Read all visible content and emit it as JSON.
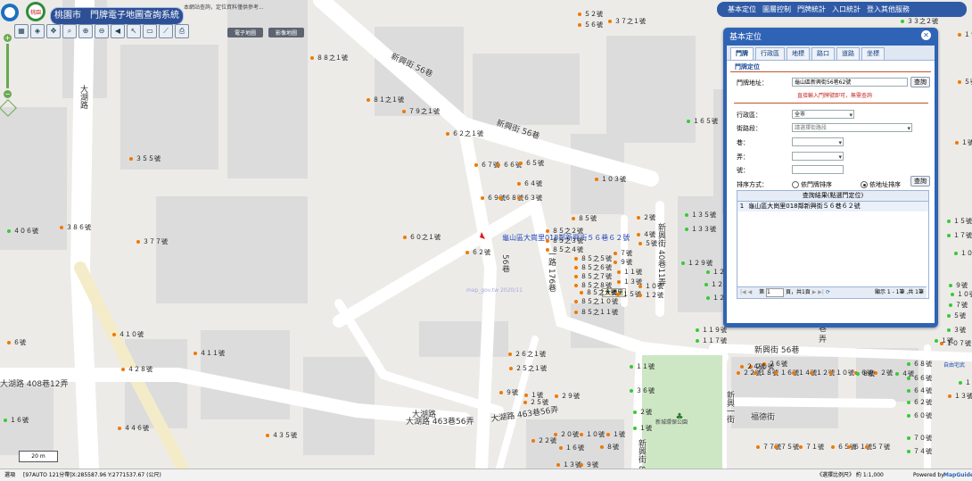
{
  "header": {
    "logo_text": "桃園",
    "title": "桃園市　門牌電子地圖查詢系統",
    "hint": "本網站查詢，定位資料僅供參考..."
  },
  "tools": {
    "map_tabs": [
      "電子地圖",
      "影像地圖"
    ]
  },
  "top_menu": [
    "基本定位",
    "圖層控制",
    "門牌統計",
    "入口統計",
    "登入其他服務"
  ],
  "panel": {
    "title": "基本定位",
    "close": "✕",
    "tabs": [
      "門牌",
      "行政區",
      "地標",
      "路口",
      "道路",
      "坐標"
    ],
    "section": "門牌定位",
    "address_label": "門牌地址：",
    "address_value": "龜山區新興街56巷62號",
    "query_button": "查詢",
    "tip": "直接輸入門牌號即可，無需查詢",
    "district_label": "行政區：",
    "district_value": "全市",
    "street_label": "街路段：",
    "street_placeholder": "請選擇街路段",
    "lane_label": "巷：",
    "alley_label": "弄：",
    "number_label": "號：",
    "sort_label": "排序方式：",
    "sort_option1": "依門牌排序",
    "sort_option2": "依地址排序",
    "query_button2": "查詢",
    "grid_header": "查詢結果(點選門定位)",
    "grid_row_index": "1",
    "grid_row_value": "龜山區大崗里018鄰新興街５６巷６２號",
    "pager_label": "第",
    "pager_value": "1",
    "pager_total": "頁，共1頁",
    "pager_info": "顯示 1 - 1筆 ,共 1筆"
  },
  "map_labels": {
    "roads": {
      "xinxing56a": "新興街 56巷",
      "xinxing56b": "新興街 56巷",
      "dahu": "大湖路",
      "dahu_b": "大湖路",
      "dahu408": "大湖路 408巷12弄",
      "dahu463": "大湖路 463巷56弄",
      "dahu463b": "大湖路 463巷56弄",
      "lane176": "一路 176巷",
      "lane56v": "56巷",
      "xinxing40": "新興街 40巷11弄",
      "xinxing56c": "新興街 56巷",
      "fude": "福德街",
      "xinxing1": "新興一街",
      "lane85": "新興街 85巷",
      "lane_small": "巷 弄"
    },
    "marker_label": "龜山區大崗里018鄰新興街５６巷６２號",
    "tooltip": "大崗里",
    "watermark": "map_gov.tw 2020/11",
    "park": "新城環保公園",
    "baghuo": "自由宅武"
  },
  "addresses_orange": [
    [
      "５２號",
      648,
      12
    ],
    [
      "５６號",
      648,
      24
    ],
    [
      "３７之１號",
      682,
      20
    ],
    [
      "８８之１號",
      348,
      61
    ],
    [
      "８１之１號",
      411,
      108
    ],
    [
      "７９之１號",
      451,
      121
    ],
    [
      "６２之１號",
      500,
      146
    ],
    [
      "６７號",
      532,
      181
    ],
    [
      "６６號",
      557,
      181
    ],
    [
      "６５號",
      582,
      179
    ],
    [
      "３５５號",
      145,
      174
    ],
    [
      "６４號",
      580,
      202
    ],
    [
      "６９號",
      539,
      218
    ],
    [
      "６８號",
      559,
      218
    ],
    [
      "６３號",
      580,
      218
    ],
    [
      "１０３號",
      667,
      197
    ],
    [
      "３８６號",
      67,
      251
    ],
    [
      "３７７號",
      153,
      267
    ],
    [
      "６０之１號",
      452,
      262
    ],
    [
      "６２號",
      522,
      279
    ],
    [
      "８５號",
      641,
      241
    ],
    [
      "８５之２號",
      612,
      255
    ],
    [
      "８５之３號",
      612,
      266
    ],
    [
      "８５之４號",
      612,
      276
    ],
    [
      "８５之５號",
      644,
      286
    ],
    [
      "８５之６號",
      644,
      296
    ],
    [
      "８５之７號",
      644,
      306
    ],
    [
      "８５之８號",
      644,
      316
    ],
    [
      "８５之９號",
      650,
      324
    ],
    [
      "８５之１０號",
      644,
      334
    ],
    [
      "８５之１１號",
      644,
      346
    ],
    [
      "２號",
      714,
      240
    ],
    [
      "４號",
      714,
      259
    ],
    [
      "５號",
      716,
      269
    ],
    [
      "７號",
      688,
      280
    ],
    [
      "９號",
      688,
      290
    ],
    [
      "１１號",
      692,
      301
    ],
    [
      "１３號",
      692,
      312
    ],
    [
      "１５號",
      691,
      326
    ],
    [
      "１０號",
      716,
      317
    ],
    [
      "１２號",
      716,
      327
    ],
    [
      "６號",
      8,
      380
    ],
    [
      "４１０號",
      126,
      371
    ],
    [
      "４１１號",
      217,
      392
    ],
    [
      "４２８號",
      136,
      410
    ],
    [
      "２６之１號",
      570,
      393
    ],
    [
      "２５之１號",
      571,
      409
    ],
    [
      "９號",
      560,
      436
    ],
    [
      "１號",
      588,
      439
    ],
    [
      "２５號",
      587,
      447
    ],
    [
      "２９號",
      622,
      440
    ],
    [
      "４４６號",
      132,
      476
    ],
    [
      "４３５號",
      298,
      484
    ],
    [
      "２２號",
      596,
      490
    ],
    [
      "２０號",
      621,
      483
    ],
    [
      "１０號",
      650,
      483
    ],
    [
      "１號",
      680,
      483
    ],
    [
      "１６號",
      627,
      498
    ],
    [
      "８號",
      673,
      497
    ],
    [
      "１３號",
      624,
      517
    ],
    [
      "９號",
      650,
      517
    ],
    [
      "１９號",
      1074,
      35
    ],
    [
      "５號",
      1074,
      88
    ],
    [
      "１號",
      1071,
      156
    ],
    [
      "１３號",
      1063,
      440
    ],
    [
      "１０７號",
      1054,
      381
    ],
    [
      "２０號",
      840,
      407
    ],
    [
      "２６號",
      855,
      404
    ],
    [
      "２４號",
      830,
      407
    ],
    [
      "２２號",
      826,
      414
    ],
    [
      "１８號",
      845,
      414
    ],
    [
      "１６號",
      868,
      414
    ],
    [
      "１４號",
      888,
      414
    ],
    [
      "１２號",
      908,
      414
    ],
    [
      "１０號",
      930,
      414
    ],
    [
      "６號",
      958,
      414
    ],
    [
      "２號",
      980,
      414
    ],
    [
      "７７號",
      848,
      497
    ],
    [
      "７５號",
      868,
      497
    ],
    [
      "７１號",
      896,
      497
    ],
    [
      "６５號",
      932,
      497
    ],
    [
      "６１號",
      950,
      497
    ],
    [
      "５７號",
      970,
      497
    ]
  ],
  "addresses_green": [
    [
      "３２之１號",
      1006,
      8
    ],
    [
      "３３之２號",
      1010,
      20
    ],
    [
      "１６５號",
      770,
      132
    ],
    [
      "１３５號",
      768,
      237
    ],
    [
      "１３３號",
      768,
      253
    ],
    [
      "１２９號",
      764,
      291
    ],
    [
      "１２７號",
      792,
      301
    ],
    [
      "１２５號",
      790,
      315
    ],
    [
      "１２３號",
      792,
      330
    ],
    [
      "１１９號",
      780,
      366
    ],
    [
      "１１７號",
      780,
      378
    ],
    [
      "１５號",
      1062,
      244
    ],
    [
      "１７號",
      1062,
      260
    ],
    [
      "１０６號",
      1070,
      280
    ],
    [
      "９號",
      1064,
      316
    ],
    [
      "７號",
      1064,
      338
    ],
    [
      "５號",
      1062,
      350
    ],
    [
      "３號",
      1062,
      366
    ],
    [
      "１號",
      1048,
      378
    ],
    [
      "１０號",
      1066,
      326
    ],
    [
      "１１號",
      706,
      407
    ],
    [
      "３６號",
      706,
      434
    ],
    [
      "２號",
      710,
      458
    ],
    [
      "１號",
      710,
      476
    ],
    [
      "４０６號",
      8,
      255
    ],
    [
      "１６號",
      4,
      467
    ],
    [
      "１９號",
      1075,
      425
    ],
    [
      "６８號",
      1017,
      404
    ],
    [
      "６６號",
      1017,
      420
    ],
    [
      "６４號",
      1017,
      434
    ],
    [
      "６２號",
      1017,
      447
    ],
    [
      "６０號",
      1017,
      462
    ],
    [
      "７０號",
      1017,
      487
    ],
    [
      "７４號",
      1017,
      502
    ],
    [
      "４號",
      1004,
      415
    ],
    [
      "８號",
      960,
      415
    ]
  ],
  "status": {
    "left": "選項",
    "coords": "[97AUTO 121分帶]X:285587.96 Y:2771537.67 (公尺)",
    "scale": "《選擇比例尺》 約 1:1,000",
    "powered": "Powered by",
    "mapguide": "MapGuide",
    "scalebar": "20 m"
  }
}
